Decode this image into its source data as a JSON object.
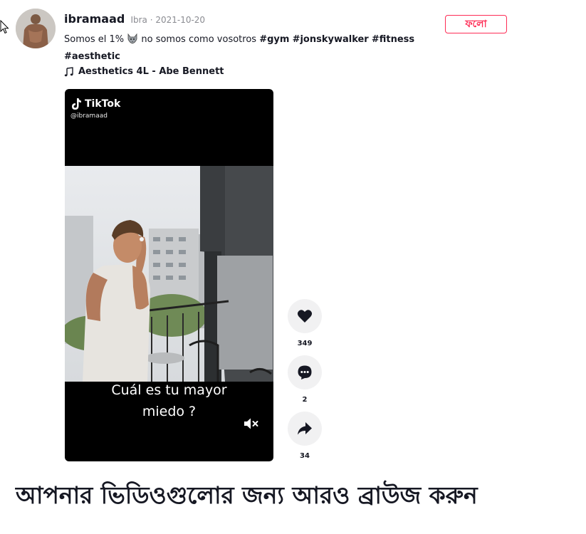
{
  "post": {
    "username": "ibramaad",
    "meta": "Ibra · 2021-10-20",
    "follow_label": "ফলো",
    "caption_text": "Somos el 1%",
    "caption_emoji": "wolf-emoji",
    "caption_text2": "no somos como vosotros",
    "hashtags": [
      "#gym",
      "#jonskywalker",
      "#fitness",
      "#aesthetic"
    ],
    "music": "Aesthetics 4L - Abe Bennett"
  },
  "video": {
    "brand": "TikTok",
    "handle": "@ibramaad",
    "subtitle_line1": "Cuál es tu mayor",
    "subtitle_line2": "miedo ?",
    "muted": true
  },
  "actions": {
    "likes": "349",
    "comments": "2",
    "shares": "34"
  },
  "browse": {
    "title": "আপনার ভিডিওগুলোর জন্য আরও ব্রাউজ করুন"
  },
  "colors": {
    "accent": "#fe2c55",
    "text": "#161823",
    "muted": "#8a8b91",
    "action_bg": "#f1f1f2"
  },
  "icons": [
    "cursor-icon",
    "music-note-icon",
    "tiktok-logo-icon",
    "mute-icon",
    "heart-icon",
    "comment-icon",
    "share-icon"
  ]
}
